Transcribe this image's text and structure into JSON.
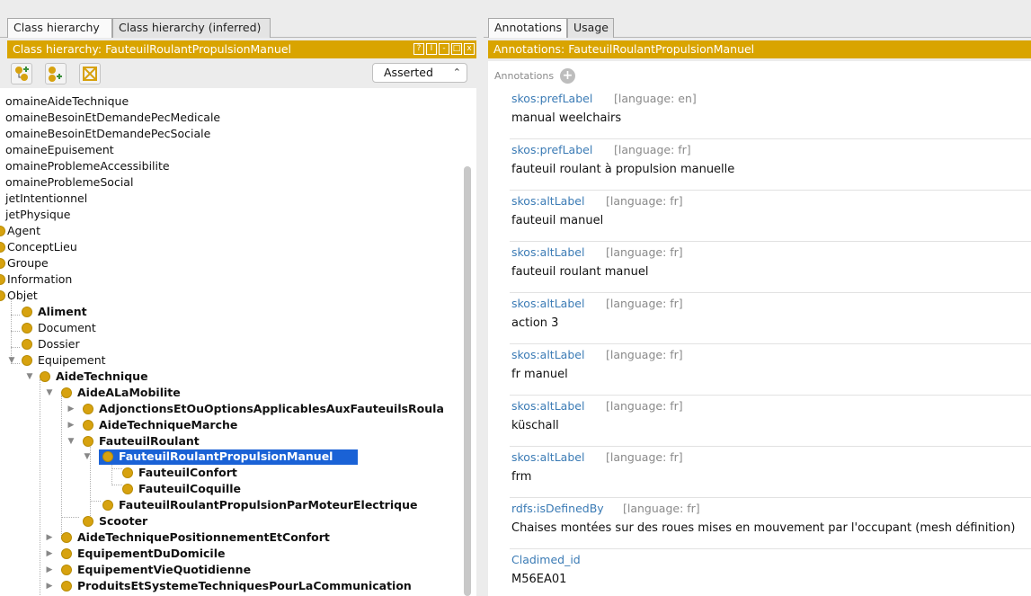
{
  "left": {
    "tabs": [
      "Class hierarchy",
      "Class hierarchy (inferred)"
    ],
    "header": "Class hierarchy: FauteuilRoulantPropulsionManuel",
    "header_btn_labels": [
      "?",
      "I",
      "-",
      "□",
      "x"
    ],
    "select_value": "Asserted",
    "tree": [
      {
        "label": "omaineAideTechnique"
      },
      {
        "label": "omaineBesoinEtDemandePecMedicale"
      },
      {
        "label": "omaineBesoinEtDemandePecSociale"
      },
      {
        "label": "omaineEpuisement"
      },
      {
        "label": "omaineProblemeAccessibilite"
      },
      {
        "label": "omaineProblemeSocial"
      },
      {
        "label": "jetIntentionnel"
      },
      {
        "label": "jetPhysique"
      },
      {
        "label": "Agent"
      },
      {
        "label": "ConceptLieu"
      },
      {
        "label": "Groupe"
      },
      {
        "label": "Information"
      },
      {
        "label": "Objet"
      },
      {
        "label": "Aliment"
      },
      {
        "label": "Document"
      },
      {
        "label": "Dossier"
      },
      {
        "label": "Equipement"
      },
      {
        "label": "AideTechnique"
      },
      {
        "label": "AideALaMobilite"
      },
      {
        "label": "AdjonctionsEtOuOptionsApplicablesAuxFauteuilsRoula"
      },
      {
        "label": "AideTechniqueMarche"
      },
      {
        "label": "FauteuilRoulant"
      },
      {
        "label": "FauteuilRoulantPropulsionManuel"
      },
      {
        "label": "FauteuilConfort"
      },
      {
        "label": "FauteuilCoquille"
      },
      {
        "label": "FauteuilRoulantPropulsionParMoteurElectrique"
      },
      {
        "label": "Scooter"
      },
      {
        "label": "AideTechniquePositionnementEtConfort"
      },
      {
        "label": "EquipementDuDomicile"
      },
      {
        "label": "EquipementVieQuotidienne"
      },
      {
        "label": "ProduitsEtSystemeTechniquesPourLaCommunication"
      }
    ]
  },
  "right": {
    "tabs": [
      "Annotations",
      "Usage"
    ],
    "header": "Annotations: FauteuilRoulantPropulsionManuel",
    "annotations_label": "Annotations",
    "annotations": [
      {
        "prop": "skos:prefLabel",
        "lang": "[language: en]",
        "value": "manual weelchairs"
      },
      {
        "prop": "skos:prefLabel",
        "lang": "[language: fr]",
        "value": "fauteuil roulant à propulsion manuelle"
      },
      {
        "prop": "skos:altLabel",
        "lang": "[language: fr]",
        "value": "fauteuil manuel"
      },
      {
        "prop": "skos:altLabel",
        "lang": "[language: fr]",
        "value": "fauteuil roulant manuel"
      },
      {
        "prop": "skos:altLabel",
        "lang": "[language: fr]",
        "value": "action 3"
      },
      {
        "prop": "skos:altLabel",
        "lang": "[language: fr]",
        "value": "fr manuel"
      },
      {
        "prop": "skos:altLabel",
        "lang": "[language: fr]",
        "value": "küschall"
      },
      {
        "prop": "skos:altLabel",
        "lang": "[language: fr]",
        "value": "frm"
      },
      {
        "prop": "rdfs:isDefinedBy",
        "lang": "[language: fr]",
        "value": "Chaises montées sur des roues mises en mouvement par l'occupant (mesh définition)"
      },
      {
        "prop": "Cladimed_id",
        "lang": "",
        "value": "M56EA01"
      }
    ]
  }
}
